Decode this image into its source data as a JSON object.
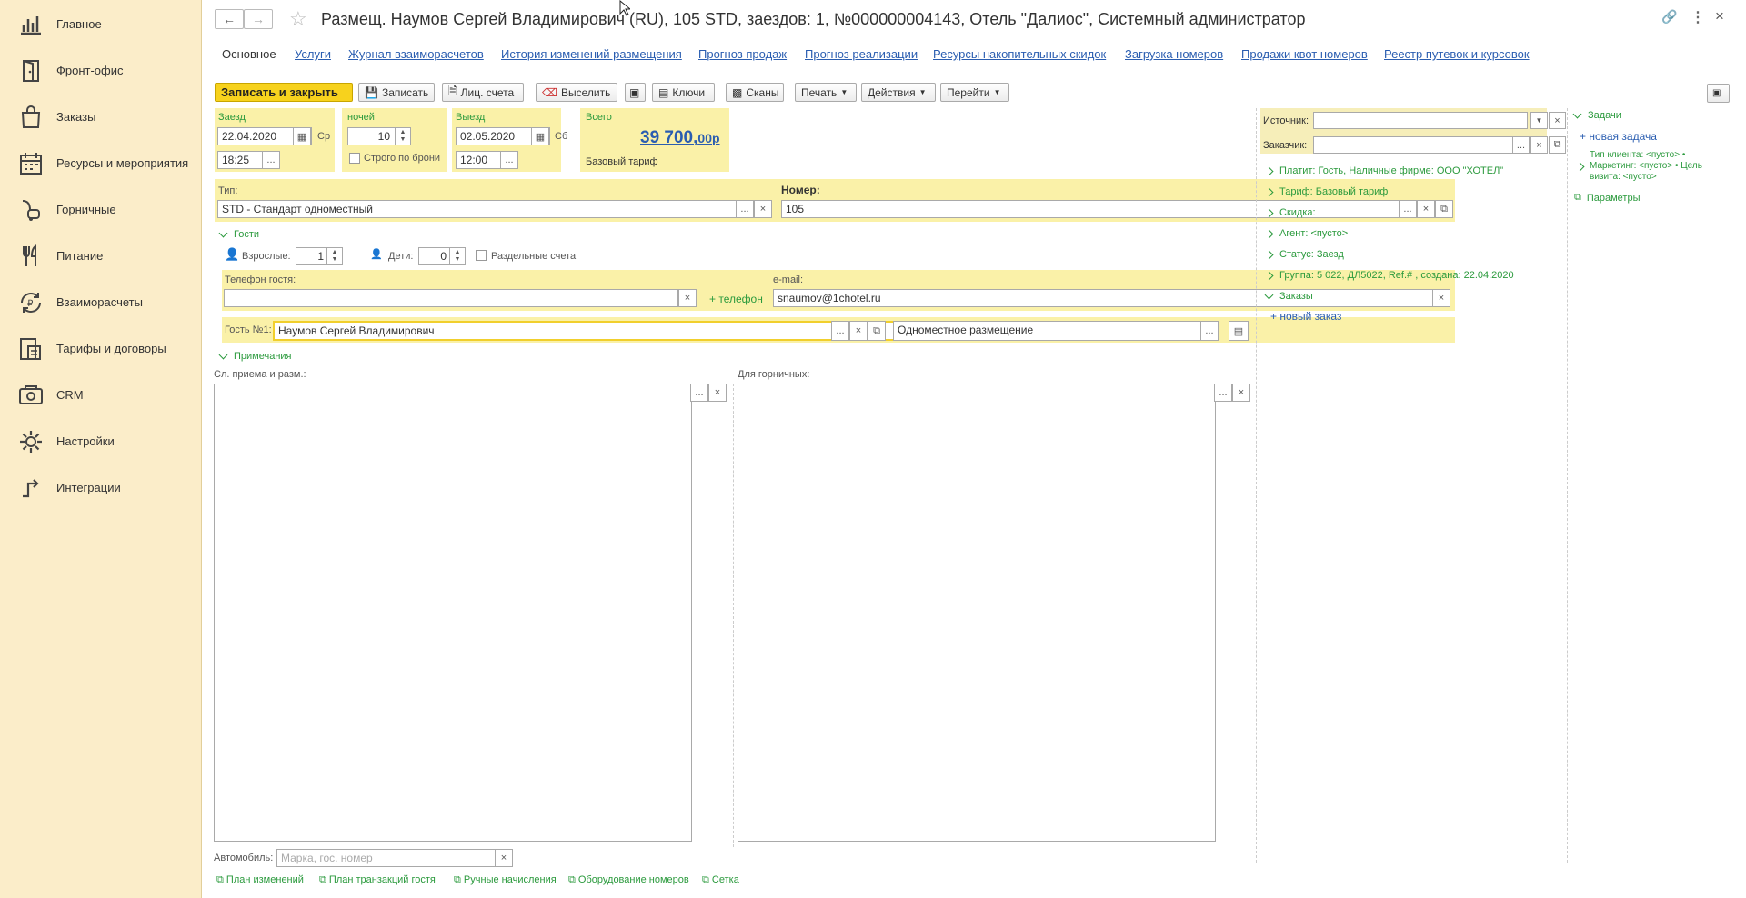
{
  "sidebar": {
    "items": [
      {
        "label": "Главное",
        "icon": "bar-chart-icon"
      },
      {
        "label": "Фронт-офис",
        "icon": "door-icon"
      },
      {
        "label": "Заказы",
        "icon": "shopping-bag-icon"
      },
      {
        "label": "Ресурсы и мероприятия",
        "icon": "calendar-icon"
      },
      {
        "label": "Горничные",
        "icon": "vacuum-icon"
      },
      {
        "label": "Питание",
        "icon": "fork-knife-icon"
      },
      {
        "label": "Взаиморасчеты",
        "icon": "currency-exchange-icon"
      },
      {
        "label": "Тарифы и договоры",
        "icon": "contract-icon"
      },
      {
        "label": "CRM",
        "icon": "crm-icon"
      },
      {
        "label": "Настройки",
        "icon": "gear-icon"
      },
      {
        "label": "Интеграции",
        "icon": "integration-icon"
      }
    ]
  },
  "header": {
    "title": "Размещ. Наумов Сергей Владимирович (RU), 105 STD, заездов: 1, №000000004143, Отель \"Далиос\", Системный администратор"
  },
  "tabs": [
    "Основное",
    "Услуги",
    "Журнал взаиморасчетов",
    "История изменений размещения",
    "Прогноз продаж",
    "Прогноз реализации",
    "Ресурсы накопительных скидок",
    "Загрузка номеров",
    "Продажи квот номеров",
    "Реестр путевок и курсовок"
  ],
  "toolbar": {
    "save_close": "Записать и закрыть",
    "save": "Записать",
    "accounts": "Лиц. счета",
    "checkout": "Выселить",
    "keys": "Ключи",
    "scans": "Сканы",
    "print": "Печать",
    "actions": "Действия",
    "goto": "Перейти"
  },
  "stay": {
    "checkin_label": "Заезд",
    "checkin_date": "22.04.2020",
    "checkin_day": "Ср",
    "checkin_time": "18:25",
    "nights_label": "ночей",
    "nights": "10",
    "strict_label": "Строго по брони",
    "checkout_label": "Выезд",
    "checkout_date": "02.05.2020",
    "checkout_day": "Сб",
    "checkout_time": "12:00",
    "total_label": "Всего",
    "total_main": "39 700,",
    "total_cents": "00р",
    "rate_label": "Базовый тариф"
  },
  "room": {
    "type_label": "Тип:",
    "type_value": "STD - Стандарт одноместный",
    "number_label": "Номер:",
    "number_value": "105"
  },
  "guests": {
    "section_label": "Гости",
    "adults_label": "Взрослые:",
    "adults": "1",
    "children_label": "Дети:",
    "children": "0",
    "split_label": "Раздельные счета",
    "phone_label": "Телефон гостя:",
    "phone_value": "",
    "add_phone": "+ телефон",
    "email_label": "e-mail:",
    "email_value": "snaumov@1chotel.ru",
    "guest_label": "Гость №1:",
    "guest_name": "Наумов Сергей Владимирович",
    "accommodation": "Одноместное размещение"
  },
  "notes": {
    "section_label": "Примечания",
    "reception_label": "Сл. приема и разм.:",
    "maid_label": "Для горничных:"
  },
  "car": {
    "label": "Автомобиль:",
    "placeholder": "Марка, гос. номер"
  },
  "footer_links": [
    "План изменений",
    "План транзакций гостя",
    "Ручные начисления",
    "Оборудование номеров",
    "Сетка"
  ],
  "right": {
    "source_label": "Источник:",
    "customer_label": "Заказчик:",
    "items": [
      "Платит: Гость, Наличные фирме: ООО \"ХОТЕЛ\"",
      "Тариф: Базовый тариф",
      "Скидка:",
      "Агент: <пусто>",
      "Статус: Заезд",
      "Группа: 5 022, ДЛ5022, Ref.# , создана: 22.04.2020"
    ],
    "orders_label": "Заказы",
    "new_order": "+ новый заказ"
  },
  "tasks": {
    "label": "Задачи",
    "new_task": "+ новая задача",
    "info": "Тип клиента: <пусто> • Маркетинг: <пусто> • Цель визита: <пусто>",
    "params": "Параметры"
  },
  "colors": {
    "sidebar_bg": "#fbedc9",
    "accent_yellow": "#f7d21d",
    "field_yellow": "#faf1a8",
    "link_blue": "#2a5db0",
    "link_green": "#2b9a3d"
  }
}
